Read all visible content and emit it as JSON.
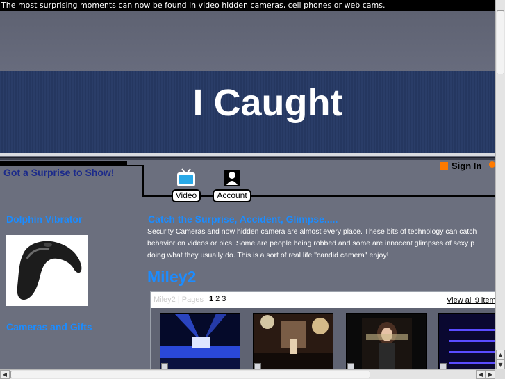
{
  "topbar": {
    "text": "The most surprising moments can now be found in video hidden cameras, cell phones or web cams."
  },
  "header": {
    "title": "I Caught"
  },
  "nav": {
    "surprise_link": "Got a Surprise to Show!",
    "video_label": "Video",
    "account_label": "Account",
    "signin_label": "Sign In"
  },
  "sidebar": {
    "product_heading": "Dolphin Vibrator",
    "cameras_heading": "Cameras and Gifts"
  },
  "main": {
    "heading": "Catch the Surprise, Accident, Glimpse.....",
    "paragraph_lines": [
      "Security Cameras and now hidden camera are almost every place. These bits of technology can catch",
      "behavior on videos or pics. Some are people being robbed and some are innocent glimpses of sexy p",
      "doing what they usually do. This is a sort of real life \"candid camera\" enjoy!"
    ],
    "gallery_title": "Miley2"
  },
  "gallery": {
    "faded_label": "Miley2 | Pages",
    "pages": [
      "1",
      "2",
      "3"
    ],
    "current_page": "1",
    "view_all": "View all 9 item"
  },
  "colors": {
    "link_blue": "#1c8cff",
    "header_band": "#2a3d68",
    "page_bg": "#6b6f7e",
    "accent_orange": "#ff7a00"
  },
  "icons": [
    "tv-icon",
    "user-icon",
    "orange-square-icon",
    "scroll-up-arrow-icon",
    "scroll-down-arrow-icon",
    "scroll-left-arrow-icon",
    "scroll-right-arrow-icon"
  ]
}
